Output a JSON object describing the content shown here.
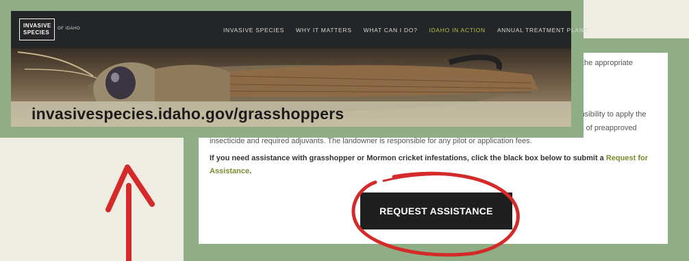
{
  "site": {
    "logo_line1": "INVASIVE",
    "logo_line2": "SPECIES",
    "logo_suffix": "OF IDAHO"
  },
  "nav": {
    "items": [
      {
        "label": "INVASIVE SPECIES",
        "active": false
      },
      {
        "label": "WHY IT MATTERS",
        "active": false
      },
      {
        "label": "WHAT CAN I DO?",
        "active": false
      },
      {
        "label": "IDAHO IN ACTION",
        "active": true
      },
      {
        "label": "ANNUAL TREATMENT PLANS",
        "active": false
      }
    ]
  },
  "hero": {
    "image_icon": "grasshopper-photo",
    "url_text": "invasivespecies.idaho.gov/grasshoppers"
  },
  "content": {
    "top_fragment": "ns on the appropriate",
    "resp_fragment": "responsibility to apply the",
    "para1": "bait and follow all In cases where insecticide bait is not the optimal treatment, ISDA will provide a reimbursement of preapproved insecticide and required adjuvants. The landowner is responsible for any pilot or application fees.",
    "para2_prefix": "If you need assistance with grasshopper or Mormon cricket infestations, click the black box below to submit a ",
    "para2_link": "Request for Assistance",
    "para2_suffix": ".",
    "request_button": "REQUEST ASSISTANCE"
  },
  "annotations": {
    "circle_icon": "red-circle-annotation",
    "arrow_icon": "red-up-arrow",
    "accent_color": "#d42a2a"
  },
  "colors": {
    "frame": "#8fae85",
    "navbar": "#232527",
    "nav_active": "#b6c04a",
    "background": "#efece2"
  }
}
